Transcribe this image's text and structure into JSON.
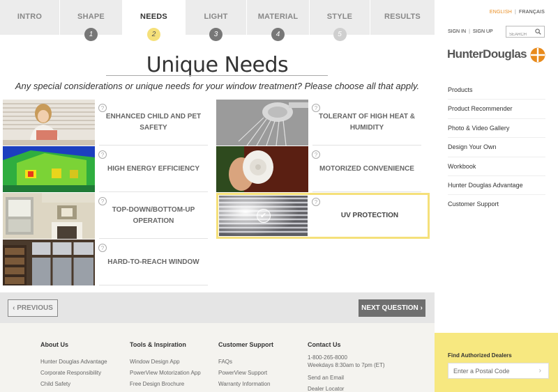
{
  "steps": [
    {
      "label": "INTRO",
      "number": ""
    },
    {
      "label": "SHAPE",
      "number": "1"
    },
    {
      "label": "NEEDS",
      "number": "2"
    },
    {
      "label": "LIGHT",
      "number": "3"
    },
    {
      "label": "MATERIAL",
      "number": "4"
    },
    {
      "label": "STYLE",
      "number": "5"
    },
    {
      "label": "RESULTS",
      "number": ""
    }
  ],
  "active_step": "NEEDS",
  "page": {
    "title": "Unique Needs",
    "subtitle": "Any special considerations or unique needs for your window treatment? Please choose all that apply."
  },
  "options": [
    {
      "label": "ENHANCED CHILD AND PET SAFETY",
      "help": "?",
      "selected": false
    },
    {
      "label": "TOLERANT OF HIGH HEAT & HUMIDITY",
      "help": "?",
      "selected": false
    },
    {
      "label": "HIGH ENERGY EFFICIENCY",
      "help": "?",
      "selected": false
    },
    {
      "label": "MOTORIZED CONVENIENCE",
      "help": "?",
      "selected": false
    },
    {
      "label": "TOP-DOWN/BOTTOM-UP OPERATION",
      "help": "?",
      "selected": false
    },
    {
      "label": "UV PROTECTION",
      "help": "?",
      "selected": true
    },
    {
      "label": "HARD-TO-REACH WINDOW",
      "help": "?",
      "selected": false
    }
  ],
  "nav": {
    "prev_label": "‹  PREVIOUS",
    "next_label": "NEXT QUESTION  ›"
  },
  "footer": {
    "columns": [
      {
        "heading": "About Us",
        "links": [
          "Hunter Douglas Advantage",
          "Corporate Responsibility",
          "Child Safety"
        ]
      },
      {
        "heading": "Tools & Inspiration",
        "links": [
          "Window Design App",
          "PowerView Motorization App",
          "Free Design Brochure"
        ]
      },
      {
        "heading": "Customer Support",
        "links": [
          "FAQs",
          "PowerView Support",
          "Warranty Information"
        ]
      },
      {
        "heading": "Contact Us",
        "links": [
          "1-800-265-8000",
          "Weekdays 8:30am to 7pm (ET)",
          "Send an Email",
          "Dealer Locator"
        ]
      }
    ]
  },
  "sidebar": {
    "lang_active": "ENGLISH",
    "lang_sep": "|",
    "lang_other": "FRANÇAIS",
    "sign_in": "SIGN IN",
    "sign_sep": "|",
    "sign_up": "SIGN UP",
    "search_placeholder": "SEARCH",
    "logo_text": "HunterDouglas",
    "menu": [
      "Products",
      "Product Recommender",
      "Photo & Video Gallery",
      "Design Your Own",
      "Workbook",
      "Hunter Douglas Advantage",
      "Customer Support"
    ],
    "dealer_heading": "Find Authorized Dealers",
    "postal_placeholder": "Enter a Postal Code"
  },
  "colors": {
    "accent_yellow": "#f5e07a",
    "brand_orange": "#e88b1d",
    "dealer_bg": "#f7e880"
  }
}
